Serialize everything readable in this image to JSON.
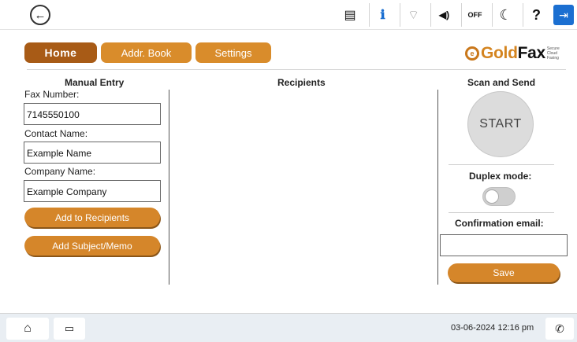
{
  "topbar": {
    "back_icon": "←",
    "status_icons": [
      {
        "name": "document-status-icon",
        "glyph": "▤"
      },
      {
        "name": "ink-info-icon",
        "glyph": "ℹ"
      },
      {
        "name": "wifi-direct-icon",
        "glyph": "⌔"
      },
      {
        "name": "speaker-icon",
        "glyph": "◀)"
      },
      {
        "name": "quiet-mode-off-icon",
        "glyph": "OFF"
      },
      {
        "name": "sleep-moon-icon",
        "glyph": "☾"
      },
      {
        "name": "help-icon",
        "glyph": "?"
      },
      {
        "name": "exit-icon",
        "glyph": "⇥"
      }
    ]
  },
  "tabs": {
    "home": "Home",
    "addr_book": "Addr. Book",
    "settings": "Settings"
  },
  "logo": {
    "mark": "e",
    "gold": "Gold",
    "fax": "Fax",
    "tagline": "Secure Cloud Faxing"
  },
  "manual_entry": {
    "title": "Manual Entry",
    "fax_label": "Fax Number:",
    "fax_value": "7145550100",
    "contact_label": "Contact Name:",
    "contact_value": "Example Name",
    "company_label": "Company Name:",
    "company_value": "Example Company",
    "add_recipients": "Add to Recipients",
    "add_subject": "Add Subject/Memo"
  },
  "recipients": {
    "title": "Recipients"
  },
  "scan_send": {
    "title": "Scan and Send",
    "start": "START",
    "duplex_label": "Duplex mode:",
    "duplex_on": false,
    "confirm_label": "Confirmation email:",
    "confirm_value": "",
    "save": "Save"
  },
  "bottombar": {
    "home_icon": "⌂",
    "task_icon": "▭",
    "datetime": "03-06-2024 12:16 pm",
    "fax_icon": "✆"
  },
  "colors": {
    "tab_active": "#a85b16",
    "tab": "#d98c2b",
    "brand_gold": "#d4841f"
  }
}
